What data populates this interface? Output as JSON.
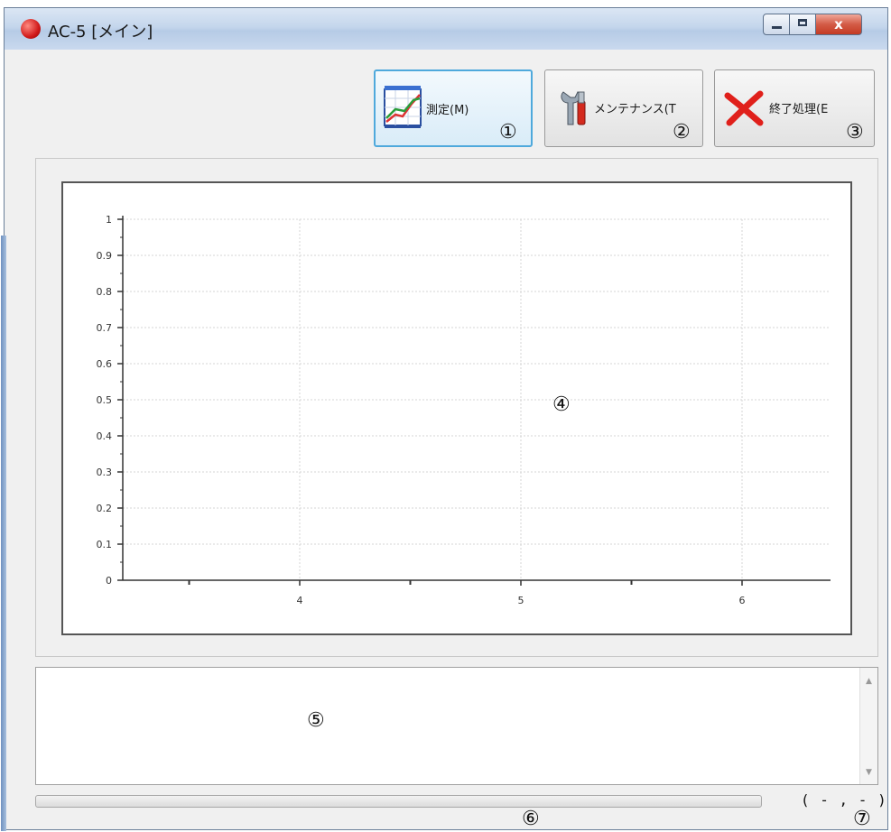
{
  "window": {
    "title": "AC-5 [メイン]",
    "close_glyph": "x"
  },
  "toolbar": {
    "measure": {
      "label": "測定(M)",
      "icon": "chart-icon",
      "callout": "①"
    },
    "maintenance": {
      "label": "メンテナンス(T",
      "icon": "tools-icon",
      "callout": "②"
    },
    "exit": {
      "label": "終了処理(E",
      "icon": "close-x-icon",
      "callout": "③"
    }
  },
  "chart": {
    "callout": "④"
  },
  "chart_data": {
    "type": "line",
    "series": [],
    "ylim": [
      0,
      1
    ],
    "yticks": [
      "0",
      "0.1",
      "0.2",
      "0.3",
      "0.4",
      "0.5",
      "0.6",
      "0.7",
      "0.8",
      "0.9",
      "1"
    ],
    "xticks": [
      "4",
      "5",
      "6"
    ],
    "grid": true
  },
  "log": {
    "text": "",
    "callout": "⑤"
  },
  "status": {
    "progress": 0,
    "progress_callout": "⑥",
    "coordinates": "( - , - )",
    "coordinates_callout": "⑦"
  },
  "colors": {
    "accent": "#4fa9dc",
    "titlebar": "#c4d6ec",
    "close": "#d35b46",
    "exit_icon": "#e0201b"
  }
}
